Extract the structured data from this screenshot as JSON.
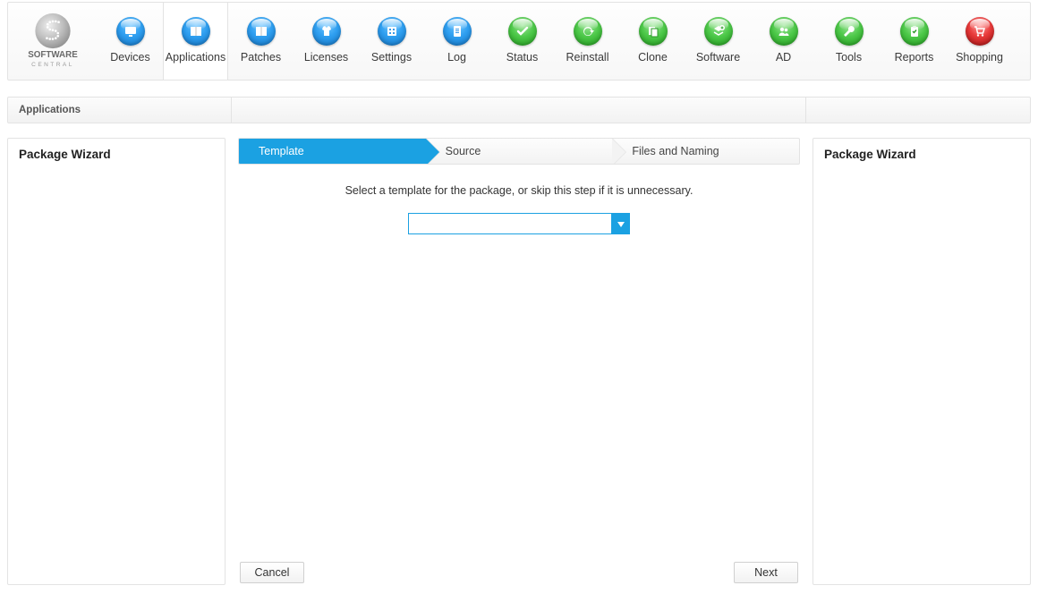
{
  "brand": {
    "top": "SOFTWARE",
    "bottom": "CENTRAL"
  },
  "nav": [
    {
      "key": "devices",
      "label": "Devices",
      "color": "blue",
      "icon": "monitor"
    },
    {
      "key": "applications",
      "label": "Applications",
      "color": "blue",
      "icon": "book",
      "active": true
    },
    {
      "key": "patches",
      "label": "Patches",
      "color": "blue",
      "icon": "book"
    },
    {
      "key": "licenses",
      "label": "Licenses",
      "color": "blue",
      "icon": "shirt"
    },
    {
      "key": "settings",
      "label": "Settings",
      "color": "blue",
      "icon": "sliders"
    },
    {
      "key": "log",
      "label": "Log",
      "color": "blue",
      "icon": "paper"
    },
    {
      "key": "status",
      "label": "Status",
      "color": "green",
      "icon": "check"
    },
    {
      "key": "reinstall",
      "label": "Reinstall",
      "color": "green",
      "icon": "cycle"
    },
    {
      "key": "clone",
      "label": "Clone",
      "color": "green",
      "icon": "copy"
    },
    {
      "key": "software",
      "label": "Software",
      "color": "green",
      "icon": "plus"
    },
    {
      "key": "ad",
      "label": "AD",
      "color": "green",
      "icon": "users"
    },
    {
      "key": "tools",
      "label": "Tools",
      "color": "green",
      "icon": "wrench"
    },
    {
      "key": "reports",
      "label": "Reports",
      "color": "green",
      "icon": "clipboard"
    },
    {
      "key": "shopping",
      "label": "Shopping",
      "color": "red",
      "icon": "cart"
    }
  ],
  "breadcrumb": {
    "section": "Applications"
  },
  "panels": {
    "left_title": "Package Wizard",
    "right_title": "Package Wizard"
  },
  "wizard": {
    "steps": [
      {
        "label": "Template",
        "current": true
      },
      {
        "label": "Source"
      },
      {
        "label": "Files and Naming"
      }
    ],
    "instruction": "Select a template for the package, or skip this step if it is unnecessary.",
    "template_value": ""
  },
  "buttons": {
    "cancel": "Cancel",
    "next": "Next"
  }
}
